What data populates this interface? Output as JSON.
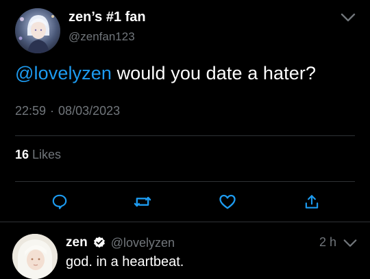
{
  "tweet": {
    "author": {
      "display_name": "zen’s #1 fan",
      "handle": "@zenfan123",
      "avatar_icon": "profile-avatar"
    },
    "text": {
      "mention": "@lovelyzen",
      "body": " would you date a hater?"
    },
    "meta": {
      "time": "22:59",
      "separator": "·",
      "date": "08/03/2023"
    },
    "likes": {
      "count": "16",
      "label": "Likes"
    },
    "actions": [
      {
        "name": "reply",
        "icon": "comment-icon"
      },
      {
        "name": "retweet",
        "icon": "retweet-icon"
      },
      {
        "name": "like",
        "icon": "heart-icon"
      },
      {
        "name": "share",
        "icon": "share-icon"
      }
    ]
  },
  "reply": {
    "display_name": "zen",
    "verified": true,
    "handle": "@lovelyzen",
    "time": "2 h",
    "text": "god. in a heartbeat."
  },
  "colors": {
    "background": "#000000",
    "text_primary": "#ffffff",
    "text_secondary": "#71767b",
    "accent": "#1d9bf0",
    "divider": "#2f3336"
  }
}
